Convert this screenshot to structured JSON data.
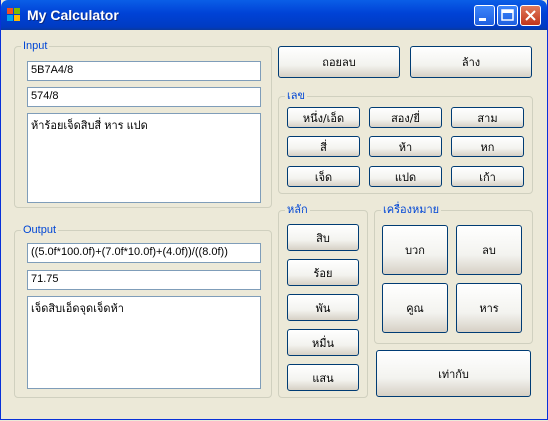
{
  "window": {
    "title": "My Calculator"
  },
  "input": {
    "legend": "Input",
    "field1": "5B7A4/8",
    "field2": "574/8",
    "text": "ห้าร้อยเจ็ดสิบสี่ หาร แปด"
  },
  "output": {
    "legend": "Output",
    "field1": "((5.0f*100.0f)+(7.0f*10.0f)+(4.0f))/((8.0f))",
    "field2": "71.75",
    "text": "เจ็ดสิบเอ็ดจุดเจ็ดห้า"
  },
  "top_buttons": {
    "backspace": "ถอยลบ",
    "clear": "ล้าง"
  },
  "numbers": {
    "legend": "เลข",
    "buttons": [
      "หนึ่ง/เอ็ด",
      "สอง/ยี่",
      "สาม",
      "สี่",
      "ห้า",
      "หก",
      "เจ็ด",
      "แปด",
      "เก้า"
    ]
  },
  "places": {
    "legend": "หลัก",
    "buttons": [
      "สิบ",
      "ร้อย",
      "พัน",
      "หมื่น",
      "แสน"
    ]
  },
  "operators": {
    "legend": "เครื่องหมาย",
    "buttons": [
      "บวก",
      "ลบ",
      "คูณ",
      "หาร"
    ]
  },
  "equals": "เท่ากับ"
}
